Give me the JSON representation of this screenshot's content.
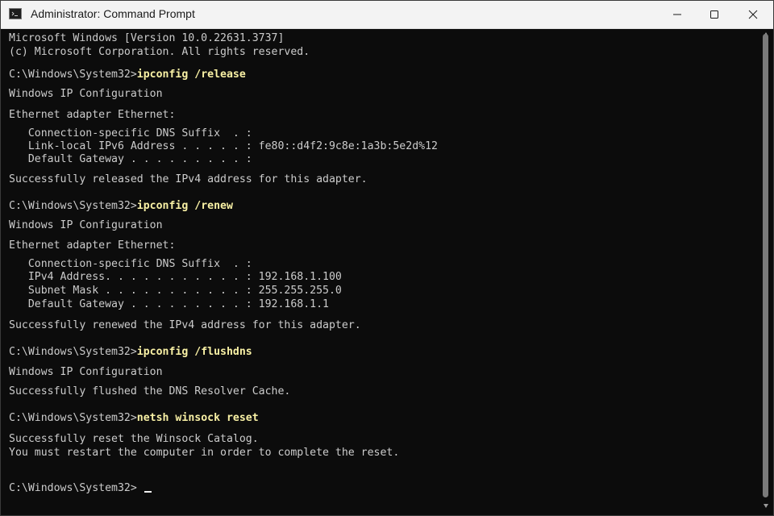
{
  "window": {
    "title": "Administrator: Command Prompt",
    "icon": "command-prompt-icon",
    "controls": [
      "minimize-icon",
      "maximize-icon",
      "close-icon"
    ]
  },
  "console": {
    "header_line1": "Microsoft Windows [Version 10.0.22631.3737]",
    "header_line2": "(c) Microsoft Corporation. All rights reserved.",
    "prompt": "C:\\Windows\\System32>",
    "cmd_release": "ipconfig /release",
    "release_out1": "Windows IP Configuration",
    "release_out2": "Ethernet adapter Ethernet:",
    "release_out3": "   Connection-specific DNS Suffix  . :",
    "release_out4": "   Link-local IPv6 Address . . . . . : fe80::d4f2:9c8e:1a3b:5e2d%12",
    "release_out5": "   Default Gateway . . . . . . . . . :",
    "release_out6": "Successfully released the IPv4 address for this adapter.",
    "cmd_renew": "ipconfig /renew",
    "renew_out1": "Windows IP Configuration",
    "renew_out2": "Ethernet adapter Ethernet:",
    "renew_out3": "   Connection-specific DNS Suffix  . :",
    "renew_out4": "   IPv4 Address. . . . . . . . . . . : 192.168.1.100",
    "renew_out5": "   Subnet Mask . . . . . . . . . . . : 255.255.255.0",
    "renew_out6": "   Default Gateway . . . . . . . . . : 192.168.1.1",
    "renew_out7": "Successfully renewed the IPv4 address for this adapter.",
    "cmd_flushdns": "ipconfig /flushdns",
    "flush_out1": "Windows IP Configuration",
    "flush_out2": "Successfully flushed the DNS Resolver Cache.",
    "cmd_winsock": "netsh winsock reset",
    "winsock_out1": "Successfully reset the Winsock Catalog.",
    "winsock_out2": "You must restart the computer in order to complete the reset."
  },
  "colors": {
    "background": "#0c0c0c",
    "text": "#cccccc",
    "command": "#f9f1a5",
    "titlebar": "#f3f3f3"
  }
}
